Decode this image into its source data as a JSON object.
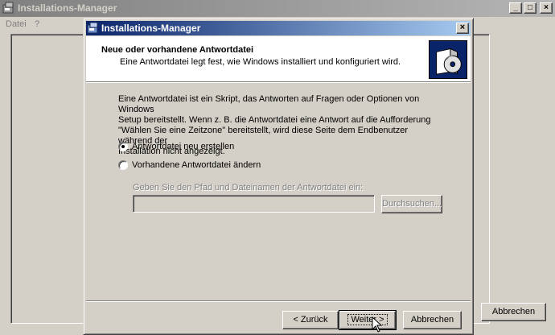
{
  "main_window": {
    "title": "Installations-Manager",
    "menu": [
      "Datei",
      "?"
    ],
    "cancel_label": "Abbrechen",
    "minimize_glyph": "_",
    "maximize_glyph": "□",
    "close_glyph": "×"
  },
  "dialog": {
    "title": "Installations-Manager",
    "close_glyph": "×",
    "header": {
      "title": "Neue oder vorhandene Antwortdatei",
      "subtitle": "Eine Antwortdatei legt fest, wie Windows installiert und konfiguriert wird.",
      "icon": "software-box-cd-icon"
    },
    "description": [
      "Eine Antwortdatei ist ein Skript, das Antworten auf Fragen oder Optionen von Windows",
      "Setup bereitstellt. Wenn z. B. die Antwortdatei eine Antwort auf die Aufforderung",
      "\"Wählen Sie eine Zeitzone\" bereitstellt, wird diese Seite dem Endbenutzer während der",
      "Installation nicht angezeigt."
    ],
    "options": [
      {
        "label": "Antwortdatei neu erstellen",
        "checked": true
      },
      {
        "label": "Vorhandene Antwortdatei ändern",
        "checked": false
      }
    ],
    "path_label": "Geben Sie den Pfad und Dateinamen der Antwortdatei ein:",
    "path_value": "",
    "browse_label": "Durchsuchen...",
    "back_label": "< Zurück",
    "next_label": "Weiter >",
    "cancel_label": "Abbrechen"
  },
  "colors": {
    "active_title_start": "#0a246a",
    "active_title_end": "#a6caf0",
    "inactive_title_start": "#808080",
    "inactive_title_end": "#b5b5b5",
    "face": "#d4d0c8"
  }
}
